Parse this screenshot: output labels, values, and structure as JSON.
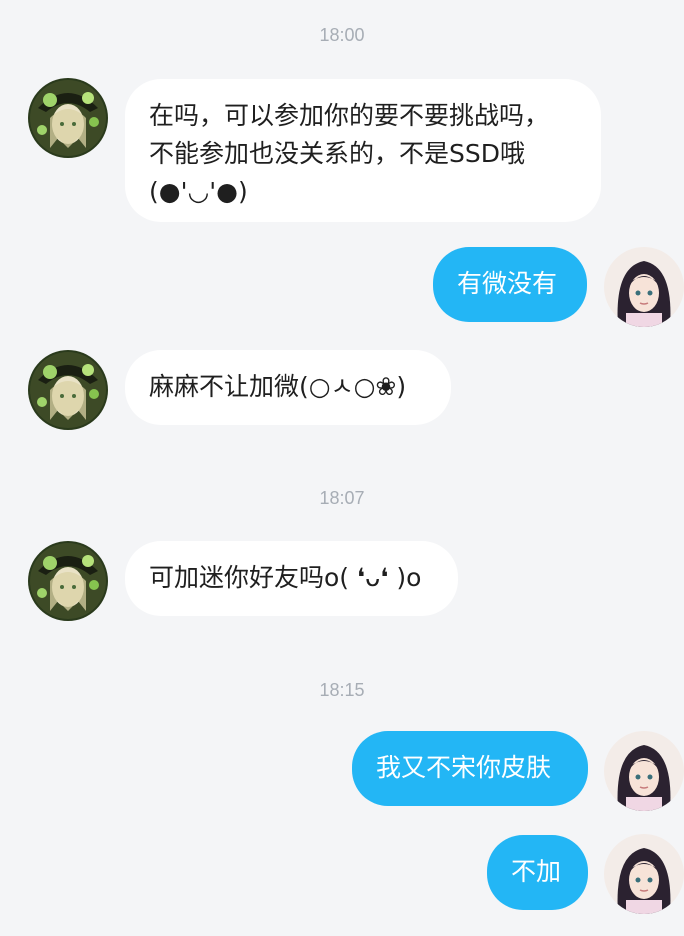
{
  "colors": {
    "background": "#f4f5f7",
    "incoming_bubble": "#ffffff",
    "outgoing_bubble": "#23b6f5",
    "timestamp": "#a7adb5"
  },
  "messages": [
    {
      "type": "timestamp",
      "text": "18:00"
    },
    {
      "type": "incoming",
      "avatar": "witch-girl-avatar-icon",
      "text": "在吗，可以参加你的要不要挑战吗，\n不能参加也没关系的，不是SSD哦\n(●'◡'●)"
    },
    {
      "type": "outgoing",
      "avatar": "dark-hair-girl-avatar-icon",
      "text": "有微没有"
    },
    {
      "type": "incoming",
      "avatar": "witch-girl-avatar-icon",
      "text": "麻麻不让加微(○ㅅ○❀)"
    },
    {
      "type": "timestamp",
      "text": "18:07"
    },
    {
      "type": "incoming",
      "avatar": "witch-girl-avatar-icon",
      "text": "可加迷你好友吗o( ❛ᴗ❛ )o"
    },
    {
      "type": "timestamp",
      "text": "18:15"
    },
    {
      "type": "outgoing",
      "avatar": "dark-hair-girl-avatar-icon",
      "text": "我又不宋你皮肤"
    },
    {
      "type": "outgoing",
      "avatar": "dark-hair-girl-avatar-icon",
      "text": "不加"
    }
  ]
}
